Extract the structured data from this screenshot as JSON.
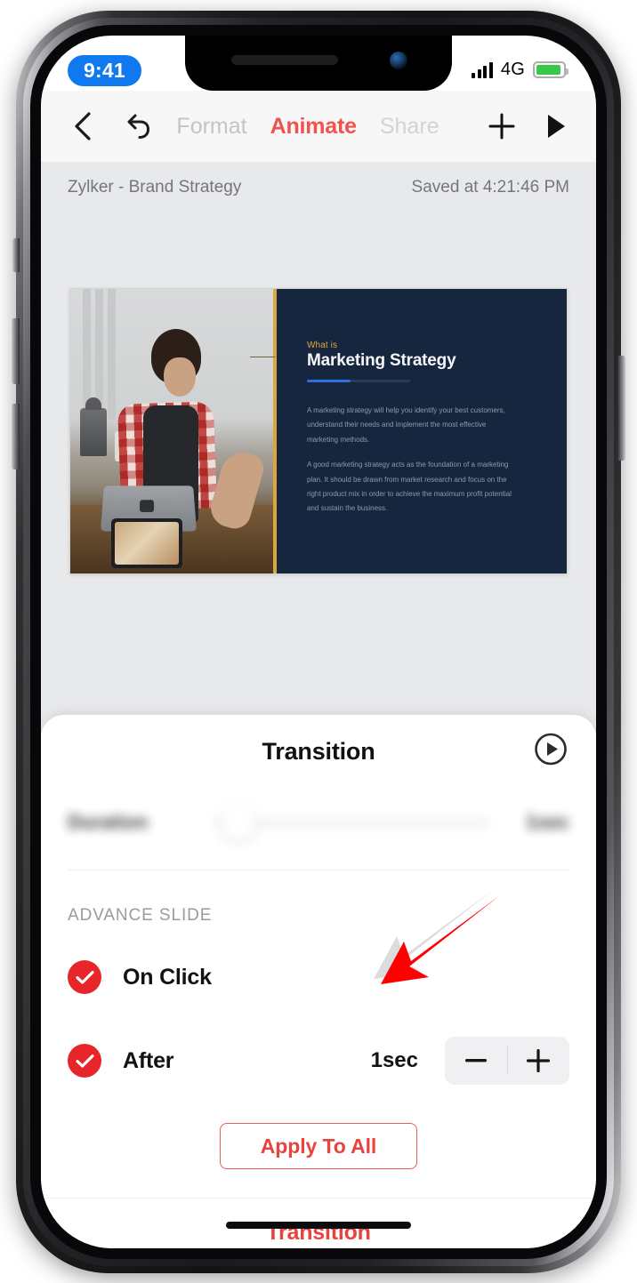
{
  "status_bar": {
    "time": "9:41",
    "network": "4G",
    "signal_icon": "signal-bars-icon",
    "battery_icon": "battery-icon"
  },
  "toolbar": {
    "back_icon": "chevron-left-icon",
    "undo_icon": "undo-icon",
    "tabs": [
      {
        "label": "Format",
        "state": "faded"
      },
      {
        "label": "Animate",
        "state": "active"
      },
      {
        "label": "Share",
        "state": "faded"
      }
    ],
    "add_icon": "plus-icon",
    "present_icon": "play-icon"
  },
  "document_bar": {
    "title": "Zylker - Brand Strategy",
    "saved_status": "Saved at 4:21:46 PM"
  },
  "slide": {
    "kicker": "What is",
    "title": "Marketing Strategy",
    "body": [
      "A marketing strategy will help you identify your best customers, understand their needs and implement the most effective marketing methods.",
      "A good marketing strategy acts as the foundation of a marketing plan. It should be drawn from market research and focus on the right product mix in order to achieve the maximum profit potential and sustain the business."
    ],
    "photo_alt": "barista-at-counter-with-laptop"
  },
  "panel": {
    "title": "Transition",
    "preview_icon": "play-circle-icon",
    "duration": {
      "label": "Duration",
      "value": "1sec"
    },
    "advance_slide": {
      "section_label": "ADVANCE SLIDE",
      "options": [
        {
          "label": "On Click",
          "checked": true
        },
        {
          "label": "After",
          "checked": true,
          "value": "1sec"
        }
      ],
      "stepper": {
        "minus": "−",
        "plus": "+"
      }
    },
    "apply_button": "Apply To All",
    "footer_tab": "Transition"
  },
  "colors": {
    "accent_red": "#E8433E",
    "check_red": "#E8262A",
    "tab_active": "#F0534E",
    "annotation_red": "#FF0000",
    "slide_navy": "#16263F",
    "slide_gold": "#D9A73C",
    "slide_blue": "#2E6FE0",
    "editor_bg": "#E8E9EB",
    "toolbar_bg": "#F7F7F8",
    "time_pill_blue": "#1179F0",
    "battery_green": "#38C94B"
  },
  "annotation": {
    "type": "arrow",
    "direction": "down-left",
    "name": "callout-arrow"
  }
}
